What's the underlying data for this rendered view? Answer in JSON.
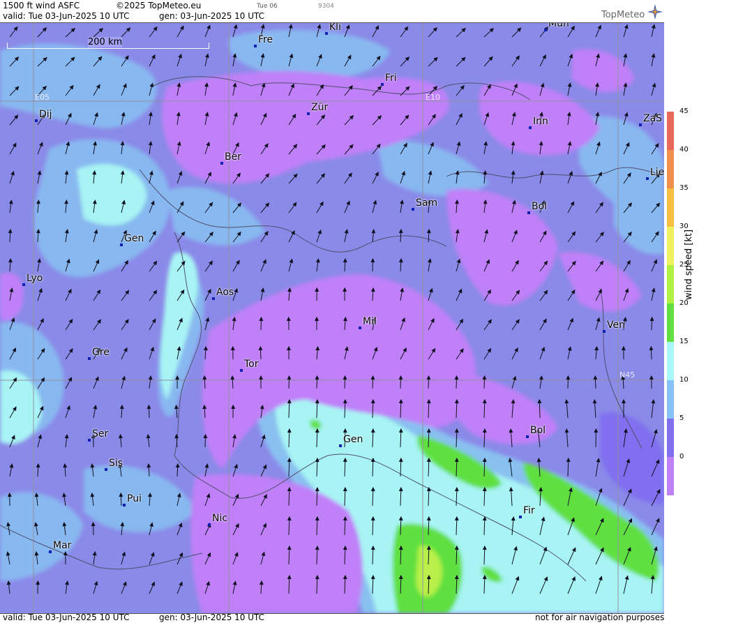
{
  "header": {
    "product": "1500 ft wind ASFC",
    "copyright": "©2025 TopMeteo.eu",
    "day_tab": "Tue 06",
    "code": "9304",
    "valid": "valid:  Tue  03-Jun-2025  10 UTC",
    "gen": "gen: 03-Jun-2025 10 UTC"
  },
  "logo": {
    "text": "TopMeteo",
    "icon": "compass-star-icon"
  },
  "scale": {
    "label": "200 km"
  },
  "grid_labels": {
    "e05": "E05",
    "e10": "E10",
    "n45": "N45"
  },
  "cities": [
    {
      "label": "Kli"
    },
    {
      "label": "Mün"
    },
    {
      "label": "Fre"
    },
    {
      "label": "Fri"
    },
    {
      "label": "Dij"
    },
    {
      "label": "Zür"
    },
    {
      "label": "Inn"
    },
    {
      "label": "ZaS"
    },
    {
      "label": "Ber"
    },
    {
      "label": "Lie"
    },
    {
      "label": "Sam"
    },
    {
      "label": "Bol"
    },
    {
      "label": "Gen"
    },
    {
      "label": "Lyo"
    },
    {
      "label": "Aos"
    },
    {
      "label": "Mil"
    },
    {
      "label": "Ven"
    },
    {
      "label": "Gre"
    },
    {
      "label": "Tor"
    },
    {
      "label": "Ser"
    },
    {
      "label": "Gen"
    },
    {
      "label": "Bol"
    },
    {
      "label": "Sis"
    },
    {
      "label": "Pui"
    },
    {
      "label": "Fir"
    },
    {
      "label": "Nic"
    },
    {
      "label": "Mar"
    }
  ],
  "legend": {
    "title": "wind speed [kt]",
    "ticks": [
      "45",
      "40",
      "35",
      "30",
      "25",
      "20",
      "15",
      "10",
      "5",
      "0"
    ],
    "colors": [
      "#e8685a",
      "#f0904c",
      "#f8c040",
      "#f0f060",
      "#b0f040",
      "#60e040",
      "#a8f8f8",
      "#88c0f8",
      "#8070f0",
      "#c080f8"
    ]
  },
  "footer": {
    "valid": "valid:  Tue  03-Jun-2025  10 UTC",
    "gen": "gen: 03-Jun-2025 10 UTC",
    "disclaimer": "not for air navigation purposes"
  }
}
